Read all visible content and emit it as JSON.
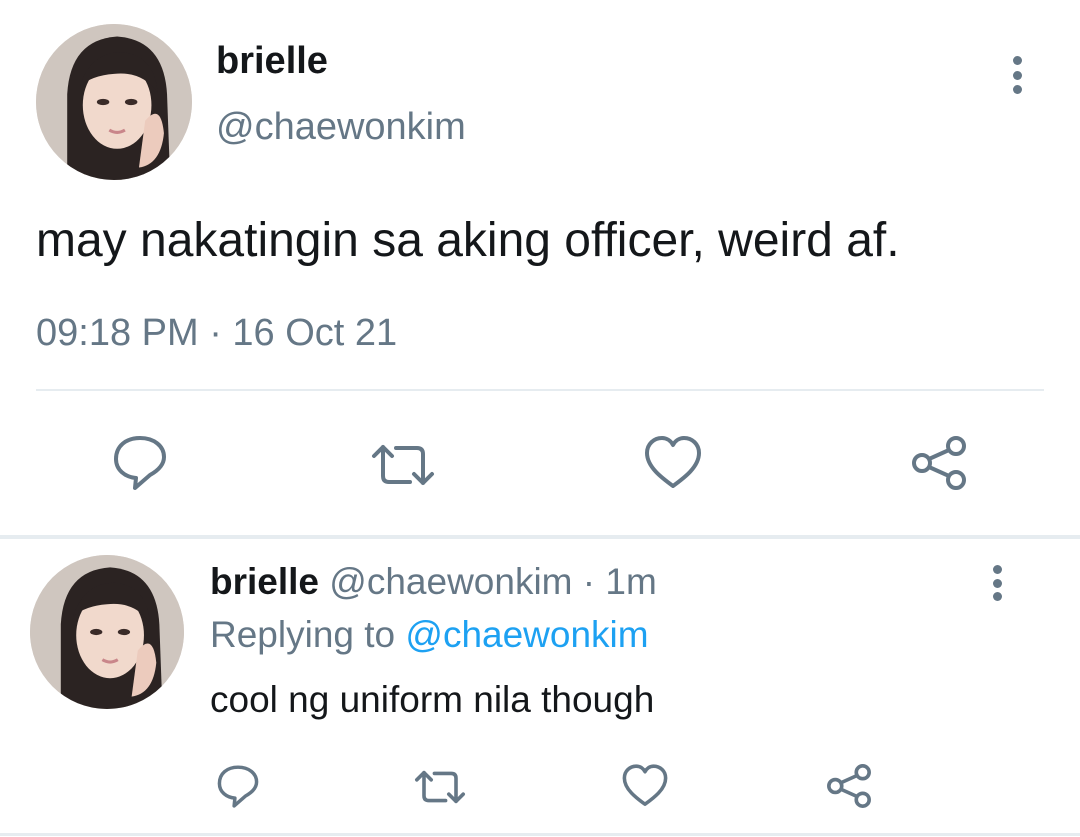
{
  "main_tweet": {
    "display_name": "brielle",
    "handle": "@chaewonkim",
    "text": "may nakatingin sa aking officer, weird af.",
    "timestamp": "09:18 PM · 16 Oct 21",
    "avatar_icon": "profile-photo",
    "actions": [
      "reply-icon",
      "retweet-icon",
      "like-icon",
      "share-icon"
    ]
  },
  "reply_tweet": {
    "display_name": "brielle",
    "handle": "@chaewonkim",
    "time_ago": "· 1m",
    "replying_prefix": "Replying to",
    "replying_handle": "@chaewonkim",
    "text": "cool ng uniform nila though",
    "avatar_icon": "profile-photo",
    "actions": [
      "reply-icon",
      "retweet-icon",
      "like-icon",
      "share-icon"
    ]
  },
  "colors": {
    "text": "#14171a",
    "muted": "#657786",
    "link": "#1da1f2",
    "divider": "#e6ecf0"
  }
}
